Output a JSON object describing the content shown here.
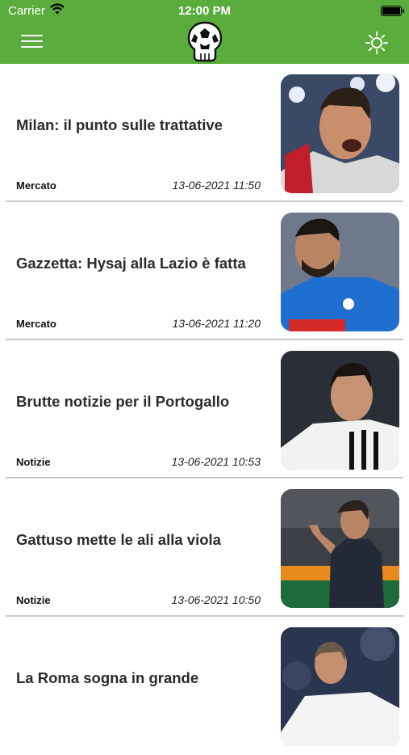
{
  "status_bar": {
    "carrier": "Carrier",
    "time": "12:00 PM"
  },
  "header": {
    "menu_icon": "hamburger-icon",
    "logo_icon": "skull-football-logo",
    "theme_icon": "sun-icon",
    "background": "#5aad3d"
  },
  "articles": [
    {
      "title": "Milan: il punto sulle trattative",
      "category": "Mercato",
      "date": "13-06-2021 11:50"
    },
    {
      "title": "Gazzetta: Hysaj alla Lazio è fatta",
      "category": "Mercato",
      "date": "13-06-2021 11:20"
    },
    {
      "title": "Brutte notizie per il Portogallo",
      "category": "Notizie",
      "date": "13-06-2021 10:53"
    },
    {
      "title": "Gattuso mette le ali alla viola",
      "category": "Notizie",
      "date": "13-06-2021 10:50"
    },
    {
      "title": "La Roma sogna in grande",
      "category": "",
      "date": ""
    }
  ]
}
